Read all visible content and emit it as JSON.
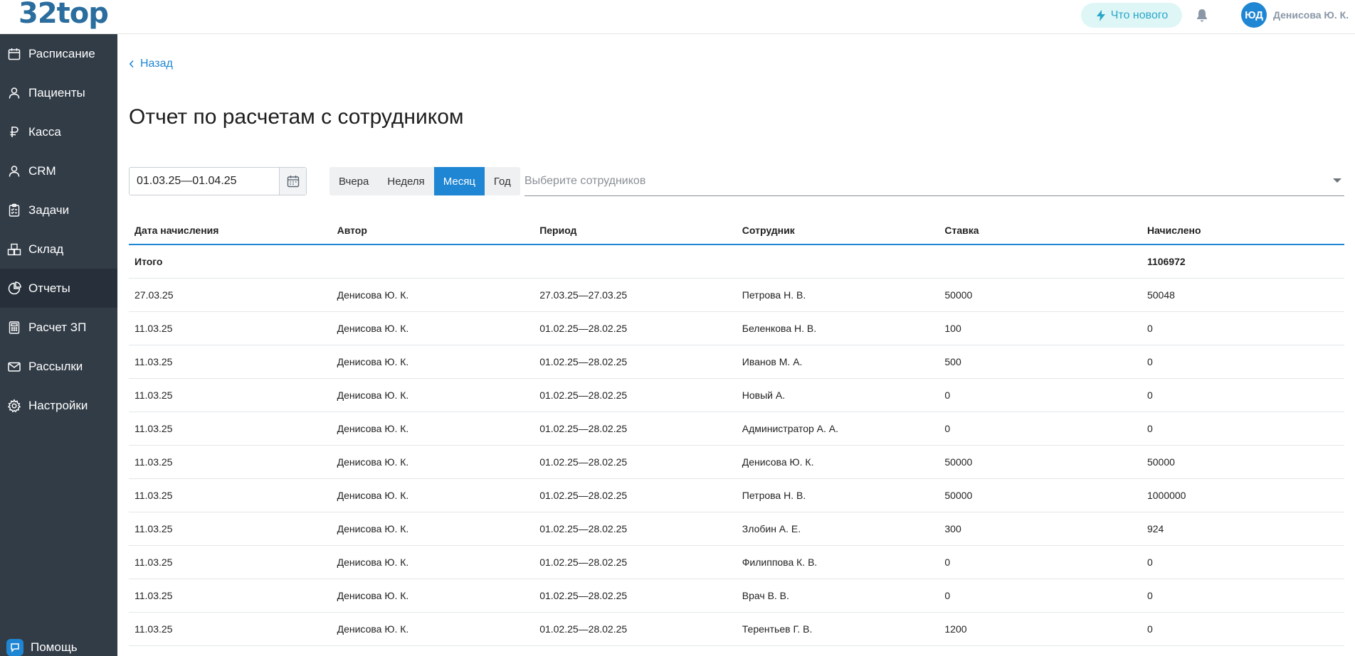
{
  "app": {
    "logo": "32top"
  },
  "header": {
    "whats_new_label": "Что нового",
    "avatar_initials": "ЮД",
    "user_name": "Денисова Ю. К."
  },
  "sidebar": {
    "items": [
      {
        "label": "Расписание",
        "icon": "calendar-icon"
      },
      {
        "label": "Пациенты",
        "icon": "user-icon"
      },
      {
        "label": "Касса",
        "icon": "ruble-icon"
      },
      {
        "label": "CRM",
        "icon": "user-icon"
      },
      {
        "label": "Задачи",
        "icon": "checklist-icon"
      },
      {
        "label": "Склад",
        "icon": "boxes-icon"
      },
      {
        "label": "Отчеты",
        "icon": "pie-chart-icon",
        "active": true
      },
      {
        "label": "Расчет ЗП",
        "icon": "calculator-icon"
      },
      {
        "label": "Рассылки",
        "icon": "mail-icon"
      },
      {
        "label": "Настройки",
        "icon": "gear-icon"
      }
    ],
    "help_label": "Помощь"
  },
  "main": {
    "back_label": "Назад",
    "title": "Отчет по расчетам с сотрудником",
    "date_range_value": "01.03.25—01.04.25",
    "period_buttons": [
      {
        "label": "Вчера",
        "active": false
      },
      {
        "label": "Неделя",
        "active": false
      },
      {
        "label": "Месяц",
        "active": true
      },
      {
        "label": "Год",
        "active": false
      }
    ],
    "employee_placeholder": "Выберите сотрудников"
  },
  "table": {
    "columns": [
      "Дата начисления",
      "Автор",
      "Период",
      "Сотрудник",
      "Ставка",
      "Начислено"
    ],
    "total": {
      "label": "Итого",
      "accrued": "1106972"
    },
    "rows": [
      [
        "27.03.25",
        "Денисова Ю. К.",
        "27.03.25—27.03.25",
        "Петрова Н. В.",
        "50000",
        "50048"
      ],
      [
        "11.03.25",
        "Денисова Ю. К.",
        "01.02.25—28.02.25",
        "Беленкова Н. В.",
        "100",
        "0"
      ],
      [
        "11.03.25",
        "Денисова Ю. К.",
        "01.02.25—28.02.25",
        "Иванов М. А.",
        "500",
        "0"
      ],
      [
        "11.03.25",
        "Денисова Ю. К.",
        "01.02.25—28.02.25",
        "Новый А.",
        "0",
        "0"
      ],
      [
        "11.03.25",
        "Денисова Ю. К.",
        "01.02.25—28.02.25",
        "Администратор А. А.",
        "0",
        "0"
      ],
      [
        "11.03.25",
        "Денисова Ю. К.",
        "01.02.25—28.02.25",
        "Денисова Ю. К.",
        "50000",
        "50000"
      ],
      [
        "11.03.25",
        "Денисова Ю. К.",
        "01.02.25—28.02.25",
        "Петрова Н. В.",
        "50000",
        "1000000"
      ],
      [
        "11.03.25",
        "Денисова Ю. К.",
        "01.02.25—28.02.25",
        "Злобин А. Е.",
        "300",
        "924"
      ],
      [
        "11.03.25",
        "Денисова Ю. К.",
        "01.02.25—28.02.25",
        "Филиппова К. В.",
        "0",
        "0"
      ],
      [
        "11.03.25",
        "Денисова Ю. К.",
        "01.02.25—28.02.25",
        "Врач В. В.",
        "0",
        "0"
      ],
      [
        "11.03.25",
        "Денисова Ю. К.",
        "01.02.25—28.02.25",
        "Терентьев Г. В.",
        "1200",
        "0"
      ]
    ]
  },
  "colors": {
    "accent": "#1f86d4",
    "sidebar": "#323c47",
    "logo": "#2a6d9e"
  }
}
